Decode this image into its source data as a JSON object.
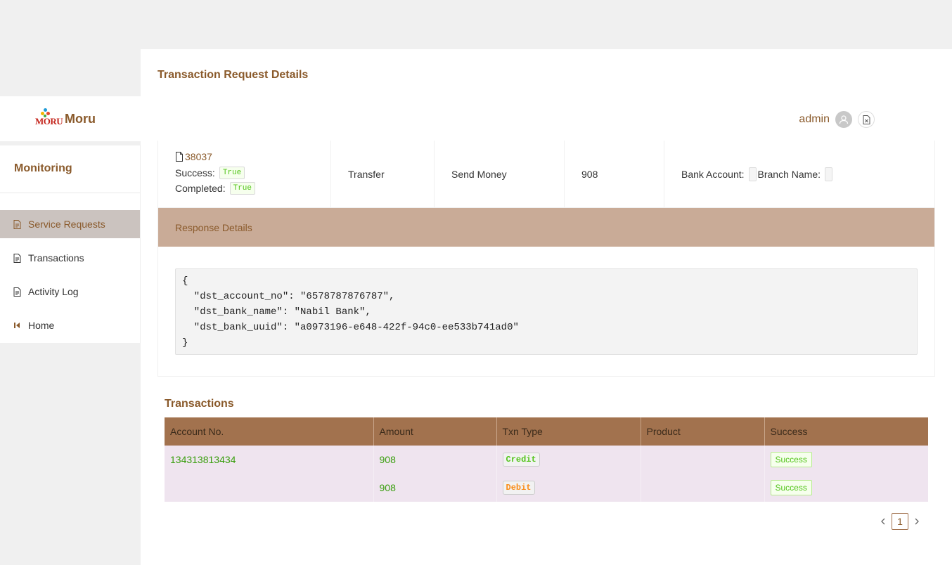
{
  "brand": {
    "name": "Moru",
    "logo_text": "MORU"
  },
  "sidebar": {
    "heading": "Monitoring",
    "items": [
      {
        "label": "Service Requests",
        "icon": "file-text-icon",
        "active": true
      },
      {
        "label": "Transactions",
        "icon": "file-text-icon"
      },
      {
        "label": "Activity Log",
        "icon": "file-text-icon"
      },
      {
        "label": "Home",
        "icon": "step-backward-icon"
      }
    ]
  },
  "header": {
    "title": "Transaction Request Details",
    "username": "admin"
  },
  "request": {
    "id": "38037",
    "success_label": "Success:",
    "success_value": "True",
    "completed_label": "Completed:",
    "completed_value": "True",
    "type": "Transfer",
    "service": "Send Money",
    "amount": "908",
    "bank_account_label": "Bank Account:",
    "branch_name_label": "Branch Name:"
  },
  "response": {
    "heading": "Response Details",
    "json": "{\n  \"dst_account_no\": \"6578787876787\",\n  \"dst_bank_name\": \"Nabil Bank\",\n  \"dst_bank_uuid\": \"a0973196-e648-422f-94c0-ee533b741ad0\"\n}"
  },
  "transactions": {
    "title": "Transactions",
    "columns": [
      "Account No.",
      "Amount",
      "Txn Type",
      "Product",
      "Success"
    ],
    "rows": [
      {
        "account": "134313813434",
        "amount": "908",
        "type": "Credit",
        "product": "",
        "success": "Success"
      },
      {
        "account": "",
        "amount": "908",
        "type": "Debit",
        "product": "",
        "success": "Success"
      }
    ]
  },
  "pagination": {
    "current": "1"
  },
  "colors": {
    "brand": "#8a5a2b",
    "table_header": "#a2724e",
    "response_header": "#c9ab97",
    "success": "#52c41a",
    "debit": "#fa8c16"
  }
}
